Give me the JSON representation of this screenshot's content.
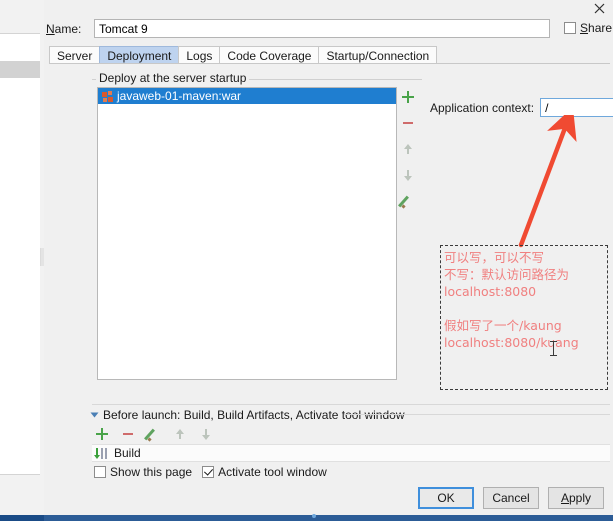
{
  "window": {
    "close_icon": "close-icon"
  },
  "name_row": {
    "label": "Name:",
    "label_mnemonic": "N",
    "value": "Tomcat 9",
    "share_label": "Share",
    "share_mnemonic": "S",
    "share_checked": false
  },
  "tabs": [
    {
      "label": "Server",
      "selected": false
    },
    {
      "label": "Deployment",
      "selected": true
    },
    {
      "label": "Logs",
      "selected": false
    },
    {
      "label": "Code Coverage",
      "selected": false
    },
    {
      "label": "Startup/Connection",
      "selected": false
    }
  ],
  "deploy_group": {
    "title": "Deploy at the server startup",
    "items": [
      {
        "label": "javaweb-01-maven:war",
        "selected": true
      }
    ],
    "toolbar": [
      {
        "name": "add-button",
        "icon": "plus-icon"
      },
      {
        "name": "remove-button",
        "icon": "minus-icon"
      },
      {
        "name": "move-up-button",
        "icon": "arrow-up-icon"
      },
      {
        "name": "move-down-button",
        "icon": "arrow-down-icon"
      },
      {
        "name": "edit-button",
        "icon": "pencil-icon"
      }
    ]
  },
  "application_context": {
    "label": "Application context:",
    "value": "/",
    "options": [
      "/"
    ]
  },
  "annotation": {
    "text": "可以写，可以不写\n不写：默认访问路径为\nlocalhost:8080\n\n假如写了一个/kaung\nlocalhost:8080/kuang",
    "color": "#f08080",
    "arrow_color": "#f04a32"
  },
  "before_launch": {
    "title": "Before launch: Build, Build Artifacts, Activate tool window",
    "title_mnemonic": "B",
    "toolbar": [
      {
        "name": "bl-add-button",
        "icon": "plus-icon"
      },
      {
        "name": "bl-remove-button",
        "icon": "minus-icon"
      },
      {
        "name": "bl-edit-button",
        "icon": "pencil-icon"
      },
      {
        "name": "bl-move-up-button",
        "icon": "arrow-up-icon"
      },
      {
        "name": "bl-move-down-button",
        "icon": "arrow-down-icon"
      }
    ],
    "rows": [
      {
        "label": "Build",
        "icon": "build-icon"
      }
    ],
    "show_this_page": {
      "label": "Show this page",
      "checked": false
    },
    "activate_tool_window": {
      "label": "Activate tool window",
      "checked": true
    }
  },
  "buttons": {
    "ok": "OK",
    "cancel": "Cancel",
    "apply": "Apply",
    "apply_mnemonic": "A"
  }
}
